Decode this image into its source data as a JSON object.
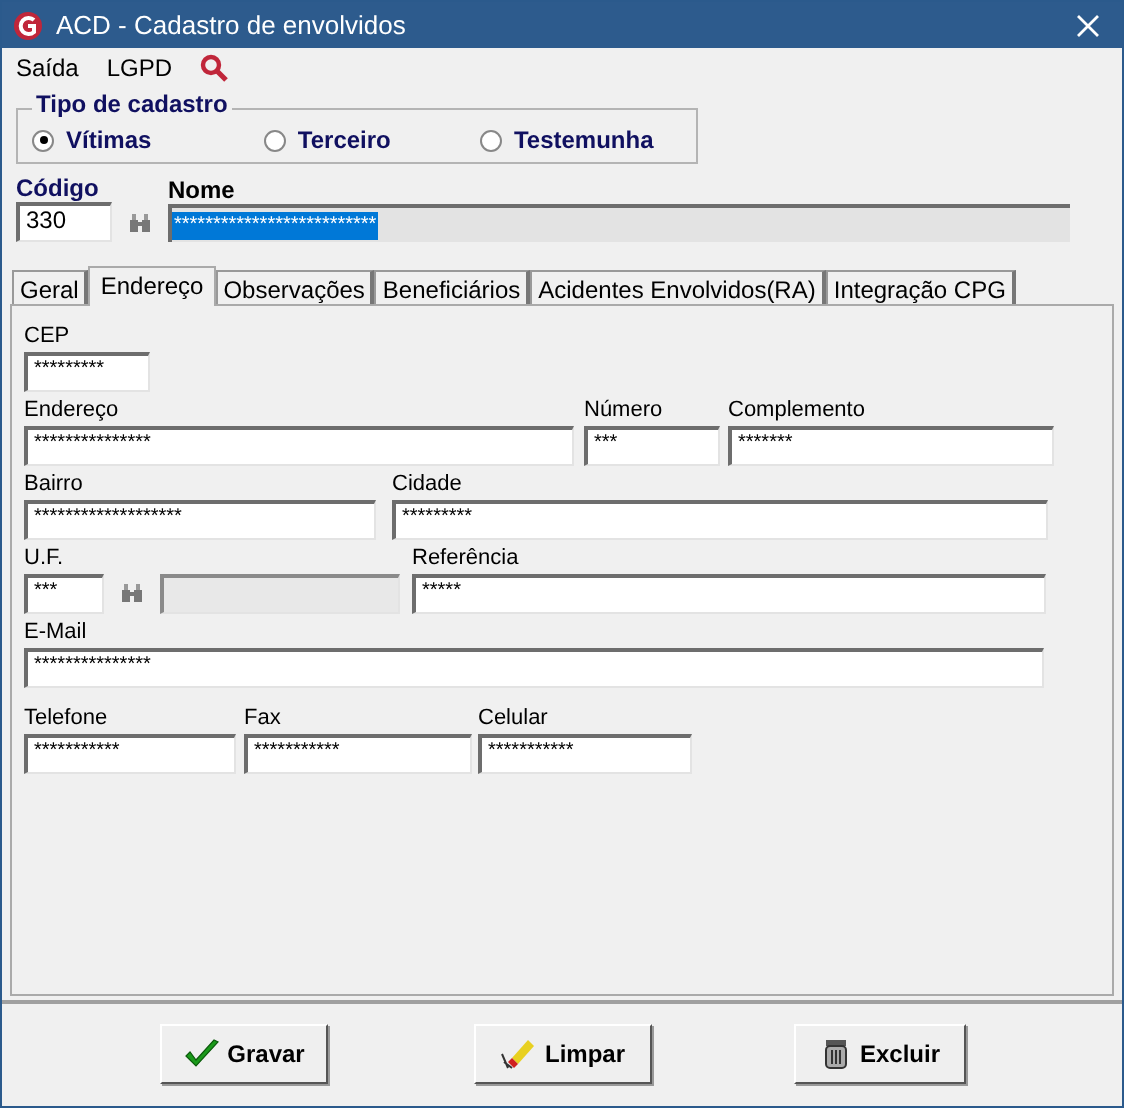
{
  "window": {
    "title": "ACD - Cadastro de envolvidos"
  },
  "menu": [
    {
      "label": "Saída",
      "kind": "text"
    },
    {
      "label": "LGPD",
      "kind": "text"
    },
    {
      "kind": "search"
    }
  ],
  "tipo_de_cadastro": {
    "title": "Tipo de cadastro",
    "options": [
      {
        "label": "Vítimas",
        "selected": true
      },
      {
        "label": "Terceiro",
        "selected": false
      },
      {
        "label": "Testemunha",
        "selected": false
      }
    ]
  },
  "codigo": {
    "label": "Código",
    "value": "330"
  },
  "nome": {
    "label": "Nome",
    "value": "**************************"
  },
  "tabs": [
    {
      "label": "Geral",
      "selected": false
    },
    {
      "label": "Endereço",
      "selected": true
    },
    {
      "label": "Observações",
      "selected": false
    },
    {
      "label": "Beneficiários",
      "selected": false
    },
    {
      "label": "Acidentes Envolvidos(RA)",
      "selected": false
    },
    {
      "label": "Integração CPG",
      "selected": false
    }
  ],
  "form_rows": [
    [
      {
        "label": "CEP",
        "value": "*********"
      }
    ],
    [
      {
        "label": "Endereço",
        "value": "***************"
      },
      {
        "label": "Número",
        "value": "***"
      },
      {
        "label": "Complemento",
        "value": "*******"
      }
    ],
    [
      {
        "label": "Bairro",
        "value": "*******************"
      },
      {
        "label": "Cidade",
        "value": "*********"
      }
    ],
    [
      {
        "label": "U.F.",
        "value": "***",
        "kind": "lookup"
      },
      {
        "label": "Referência",
        "value": "*****"
      }
    ],
    [
      {
        "label": "E-Mail",
        "value": "***************"
      }
    ],
    [
      {
        "label": "Telefone",
        "value": "***********"
      },
      {
        "label": "Fax",
        "value": "***********"
      },
      {
        "label": "Celular",
        "value": "***********"
      }
    ]
  ],
  "buttons": [
    {
      "label": "Gravar",
      "kind": "save"
    },
    {
      "label": "Limpar",
      "kind": "clear"
    },
    {
      "label": "Excluir",
      "kind": "delete"
    }
  ]
}
